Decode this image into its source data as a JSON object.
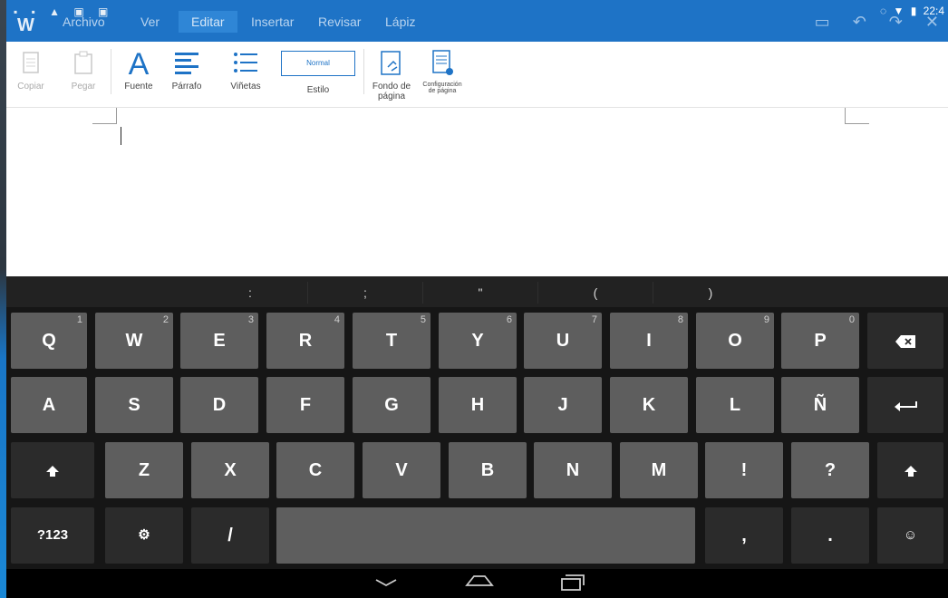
{
  "status_bar": {
    "time": "22:4"
  },
  "menu": {
    "tabs": [
      {
        "label": "Archivo"
      },
      {
        "label": "Ver"
      },
      {
        "label": "Editar"
      },
      {
        "label": "Insertar"
      },
      {
        "label": "Revisar"
      },
      {
        "label": "Lápiz"
      }
    ],
    "active_tab": "Editar"
  },
  "toolbar": {
    "copy_label": "Copiar",
    "paste_label": "Pegar",
    "font_label": "Fuente",
    "paragraph_label": "Párrafo",
    "bullets_label": "Viñetas",
    "style_label": "Estilo",
    "style_value": "Normal",
    "background_label_1": "Fondo de",
    "background_label_2": "página",
    "page_setup_label_1": "Configuración",
    "page_setup_label_2": "de página"
  },
  "keyboard": {
    "suggestions": [
      ":",
      ";",
      "\"",
      "(",
      ")"
    ],
    "row1": [
      {
        "key": "Q",
        "alt": "1"
      },
      {
        "key": "W",
        "alt": "2"
      },
      {
        "key": "E",
        "alt": "3"
      },
      {
        "key": "R",
        "alt": "4"
      },
      {
        "key": "T",
        "alt": "5"
      },
      {
        "key": "Y",
        "alt": "6"
      },
      {
        "key": "U",
        "alt": "7"
      },
      {
        "key": "I",
        "alt": "8"
      },
      {
        "key": "O",
        "alt": "9"
      },
      {
        "key": "P",
        "alt": "0"
      }
    ],
    "row2": [
      "A",
      "S",
      "D",
      "F",
      "G",
      "H",
      "J",
      "K",
      "L",
      "Ñ"
    ],
    "row3": [
      "Z",
      "X",
      "C",
      "V",
      "B",
      "N",
      "M",
      "!",
      "?"
    ],
    "symbols_label": "?123",
    "slash": "/",
    "comma": ",",
    "period": "."
  },
  "colors": {
    "header": "#1e73c6",
    "key": "#5e5e5e",
    "keyboard_bg": "#161616"
  }
}
